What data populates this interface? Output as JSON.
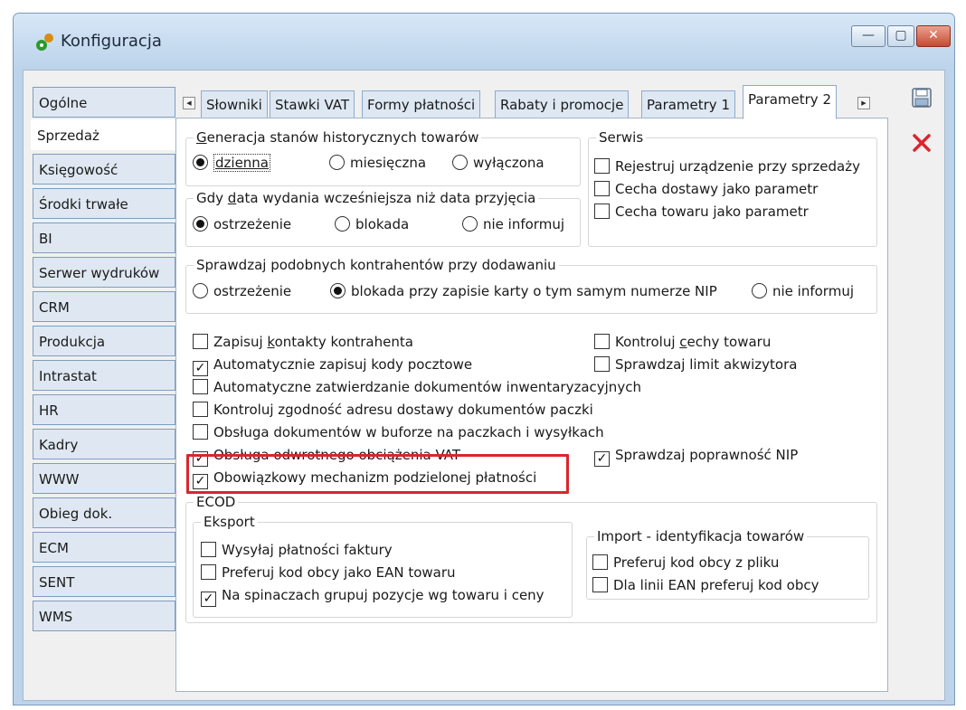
{
  "window": {
    "title": "Konfiguracja",
    "colors": {
      "accent": "#0f7d1c",
      "highlight": "#d9262e"
    }
  },
  "nav": {
    "items": [
      {
        "label": "Ogólne",
        "active": false
      },
      {
        "label": "Sprzedaż",
        "active": true
      },
      {
        "label": "Księgowość",
        "active": false
      },
      {
        "label": "Środki trwałe",
        "active": false
      },
      {
        "label": "BI",
        "active": false
      },
      {
        "label": "Serwer wydruków",
        "active": false
      },
      {
        "label": "CRM",
        "active": false
      },
      {
        "label": "Produkcja",
        "active": false
      },
      {
        "label": "Intrastat",
        "active": false
      },
      {
        "label": "HR",
        "active": false
      },
      {
        "label": "Kadry",
        "active": false
      },
      {
        "label": "WWW",
        "active": false
      },
      {
        "label": "Obieg dok.",
        "active": false
      },
      {
        "label": "ECM",
        "active": false
      },
      {
        "label": "SENT",
        "active": false
      },
      {
        "label": "WMS",
        "active": false
      }
    ]
  },
  "tabs": [
    {
      "label": "Słowniki",
      "active": false
    },
    {
      "label": "Stawki VAT",
      "active": false
    },
    {
      "label": "Formy płatności",
      "active": false
    },
    {
      "label": "Rabaty i promocje",
      "active": false
    },
    {
      "label": "Parametry 1",
      "active": false
    },
    {
      "label": "Parametry 2",
      "active": true
    }
  ],
  "generacja": {
    "title_prefix": "G",
    "title_rest": "eneracja stanów historycznych towarów",
    "option1": "dzienna",
    "option2": "miesięczna",
    "option3": "wyłączona",
    "selected": "dzienna"
  },
  "serwis": {
    "title": "Serwis",
    "items": [
      {
        "label": "Rejestruj urządzenie przy sprzedaży",
        "checked": false
      },
      {
        "label": "Cecha dostawy jako parametr",
        "checked": false
      },
      {
        "label": "Cecha towaru jako parametr",
        "checked": false
      }
    ]
  },
  "data_wydania": {
    "title_a": "Gdy ",
    "title_u": "d",
    "title_b": "ata wydania wcześniejsza niż data przyjęcia",
    "option1": "ostrzeżenie",
    "option2": "blokada",
    "option3": "nie informuj",
    "selected": "ostrzeżenie"
  },
  "kontrahenci": {
    "title": "Sprawdzaj podobnych kontrahentów przy dodawaniu",
    "option1": "ostrzeżenie",
    "option2": "blokada przy zapisie karty o tym samym numerze NIP",
    "option3": "nie informuj",
    "selected": "blokada przy zapisie karty o tym samym numerze NIP"
  },
  "options": {
    "zapisuj_kontakty": {
      "label_a": "Zapisuj ",
      "label_u": "k",
      "label_b": "ontakty kontrahenta",
      "checked": false
    },
    "kody_pocztowe": {
      "label": "Automatycznie zapisuj kody pocztowe",
      "checked": true
    },
    "zatwierdzanie": {
      "label": "Automatyczne zatwierdzanie dokumentów inwentaryzacyjnych",
      "checked": false
    },
    "adres_dostawy": {
      "label": "Kontroluj zgodność adresu dostawy dokumentów paczki",
      "checked": false
    },
    "bufor_paczki": {
      "label": "Obsługa dokumentów w buforze na paczkach i wysyłkach",
      "checked": false
    },
    "odwrotne_obciazenie": {
      "label": "Obsługa odwrotnego obciążenia VAT",
      "checked": true
    },
    "podzielona_platnosc": {
      "label": "Obowiązkowy mechanizm podzielonej płatności",
      "checked": true
    },
    "cechy_towaru": {
      "label_a": "Kontroluj ",
      "label_u": "c",
      "label_b": "echy towaru",
      "checked": false
    },
    "limit_akwizytora": {
      "label": "Sprawdzaj limit akwizytora",
      "checked": false
    },
    "poprawnosc_nip": {
      "label": "Sprawdzaj poprawność NIP",
      "checked": true
    }
  },
  "ecod": {
    "title": "ECOD",
    "eksport": {
      "title": "Eksport",
      "items": [
        {
          "label": "Wysyłaj płatności faktury",
          "checked": false
        },
        {
          "label": "Preferuj kod obcy jako EAN towaru",
          "checked": false
        },
        {
          "label": "Na spinaczach grupuj pozycje wg towaru i ceny",
          "checked": true
        }
      ]
    },
    "import": {
      "title": "Import - identyfikacja towarów",
      "items": [
        {
          "label": "Preferuj kod obcy z pliku",
          "checked": false
        },
        {
          "label": "Dla linii EAN preferuj kod obcy",
          "checked": false
        }
      ]
    }
  },
  "tools": {
    "save_icon": "save-icon",
    "delete_icon": "delete-icon"
  }
}
